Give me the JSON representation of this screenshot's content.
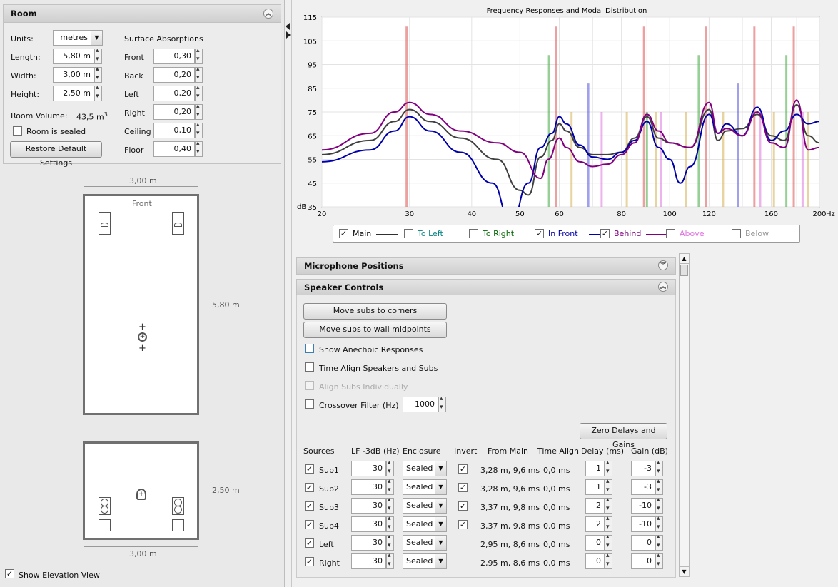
{
  "room_panel": {
    "title": "Room",
    "units_label": "Units:",
    "units_value": "metres",
    "length_label": "Length:",
    "length_value": "5,80 m",
    "width_label": "Width:",
    "width_value": "3,00 m",
    "height_label": "Height:",
    "height_value": "2,50 m",
    "volume_label": "Room Volume:",
    "volume_value": "43,5 m",
    "volume_unit_sup": "3",
    "sealed_label": "Room is sealed",
    "restore_button": "Restore Default Settings",
    "absorptions_title": "Surface Absorptions",
    "absorptions": [
      {
        "label": "Front",
        "value": "0,30"
      },
      {
        "label": "Back",
        "value": "0,20"
      },
      {
        "label": "Left",
        "value": "0,20"
      },
      {
        "label": "Right",
        "value": "0,20"
      },
      {
        "label": "Ceiling",
        "value": "0,10"
      },
      {
        "label": "Floor",
        "value": "0,40"
      }
    ]
  },
  "plan_view": {
    "width_dim": "3,00 m",
    "front_label": "Front",
    "length_dim": "5,80 m",
    "elev_width_dim": "3,00 m",
    "elev_height_dim": "2,50 m",
    "show_elevation_label": "Show Elevation View",
    "show_elevation_checked": true
  },
  "chart_data": {
    "type": "line",
    "title": "Frequency Responses and Modal Distribution",
    "ylabel": "dB",
    "xlabel": "Hz",
    "x_scale": "log",
    "x_ticks": [
      20,
      30,
      40,
      50,
      60,
      80,
      100,
      120,
      160,
      200
    ],
    "y_ticks": [
      35,
      45,
      55,
      65,
      75,
      85,
      95,
      105,
      115
    ],
    "ylim": [
      35,
      115
    ],
    "xlim": [
      20,
      200
    ],
    "grid": true,
    "series": [
      {
        "name": "Main",
        "color": "#404040",
        "x": [
          20,
          25,
          28,
          30,
          33,
          38,
          45,
          50,
          52,
          55,
          58,
          60,
          62,
          66,
          70,
          75,
          80,
          85,
          90,
          95,
          100,
          110,
          120,
          125,
          130,
          140,
          150,
          160,
          170,
          180,
          190,
          200
        ],
        "values": [
          57,
          63,
          71,
          76,
          71,
          64,
          55,
          42,
          40,
          56,
          63,
          70,
          67,
          60,
          57,
          57,
          58,
          64,
          73,
          64,
          62,
          60,
          76,
          63,
          67,
          68,
          74,
          65,
          63,
          78,
          65,
          62
        ]
      },
      {
        "name": "In Front",
        "color": "#0000aa",
        "x": [
          20,
          25,
          28,
          30,
          33,
          38,
          44,
          48,
          52,
          55,
          58,
          60,
          62,
          66,
          70,
          75,
          80,
          85,
          90,
          95,
          100,
          105,
          110,
          120,
          125,
          130,
          140,
          150,
          160,
          170,
          180,
          190,
          200
        ],
        "values": [
          54,
          59,
          67,
          73,
          67,
          58,
          45,
          28,
          45,
          60,
          66,
          73,
          70,
          61,
          56,
          55,
          58,
          63,
          71,
          60,
          55,
          45,
          52,
          74,
          66,
          70,
          65,
          77,
          63,
          67,
          74,
          70,
          71
        ]
      },
      {
        "name": "Behind",
        "color": "#800080",
        "x": [
          20,
          25,
          28,
          30,
          33,
          38,
          45,
          50,
          55,
          57,
          60,
          62,
          66,
          70,
          75,
          80,
          85,
          90,
          95,
          100,
          110,
          120,
          125,
          130,
          140,
          150,
          160,
          170,
          180,
          190,
          200
        ],
        "values": [
          59,
          66,
          75,
          79,
          74,
          67,
          62,
          58,
          47,
          55,
          64,
          60,
          54,
          52,
          53,
          57,
          62,
          74,
          67,
          62,
          60,
          79,
          66,
          68,
          65,
          75,
          62,
          60,
          80,
          59,
          60
        ]
      }
    ],
    "modes": [
      {
        "x": 29.6,
        "level": 111,
        "color": "#e06060"
      },
      {
        "x": 57.2,
        "level": 99,
        "color": "#50b050"
      },
      {
        "x": 59.2,
        "level": 111,
        "color": "#e06060"
      },
      {
        "x": 63.5,
        "level": 75,
        "color": "#d8b860"
      },
      {
        "x": 68.6,
        "level": 87,
        "color": "#6060e0"
      },
      {
        "x": 73.0,
        "level": 75,
        "color": "#e080e0"
      },
      {
        "x": 82.0,
        "level": 75,
        "color": "#d8b860"
      },
      {
        "x": 88.8,
        "level": 111,
        "color": "#e06060"
      },
      {
        "x": 90.0,
        "level": 75,
        "color": "#50b050"
      },
      {
        "x": 94.0,
        "level": 75,
        "color": "#d8b860"
      },
      {
        "x": 96.0,
        "level": 75,
        "color": "#e080e0"
      },
      {
        "x": 108.0,
        "level": 75,
        "color": "#d8b860"
      },
      {
        "x": 114.4,
        "level": 99,
        "color": "#50b050"
      },
      {
        "x": 118.4,
        "level": 111,
        "color": "#e06060"
      },
      {
        "x": 128.0,
        "level": 75,
        "color": "#d8b860"
      },
      {
        "x": 137.2,
        "level": 87,
        "color": "#6060e0"
      },
      {
        "x": 148.0,
        "level": 111,
        "color": "#e06060"
      },
      {
        "x": 152.0,
        "level": 75,
        "color": "#e080e0"
      },
      {
        "x": 162.0,
        "level": 75,
        "color": "#d8b860"
      },
      {
        "x": 171.6,
        "level": 99,
        "color": "#50b050"
      },
      {
        "x": 177.6,
        "level": 111,
        "color": "#e06060"
      },
      {
        "x": 185.0,
        "level": 75,
        "color": "#e080e0"
      },
      {
        "x": 190.0,
        "level": 75,
        "color": "#d8b860"
      }
    ],
    "legend": [
      {
        "name": "Main",
        "checked": true,
        "color": "#303030",
        "text_color": "#111111"
      },
      {
        "name": "To Left",
        "checked": false,
        "color": "#008080",
        "text_color": "#008080"
      },
      {
        "name": "To Right",
        "checked": false,
        "color": "#008000",
        "text_color": "#006600"
      },
      {
        "name": "In Front",
        "checked": true,
        "color": "#0000aa",
        "text_color": "#0000aa"
      },
      {
        "name": "Behind",
        "checked": true,
        "color": "#800080",
        "text_color": "#800080"
      },
      {
        "name": "Above",
        "checked": false,
        "color": "#e080e0",
        "text_color": "#e070e0"
      },
      {
        "name": "Below",
        "checked": false,
        "color": "#999999",
        "text_color": "#999999"
      }
    ]
  },
  "mic_panel": {
    "title": "Microphone Positions"
  },
  "speaker_panel": {
    "title": "Speaker Controls",
    "move_corners": "Move subs to corners",
    "move_midpoints": "Move subs to wall midpoints",
    "show_anechoic": "Show Anechoic Responses",
    "time_align": "Time Align Speakers and Subs",
    "align_individually": "Align Subs Individually",
    "crossover_label": "Crossover Filter (Hz)",
    "crossover_value": "1000",
    "zero_button": "Zero Delays and Gains",
    "headers": [
      "Sources",
      "LF -3dB (Hz)",
      "Enclosure",
      "Invert",
      "From Main",
      "Time Align",
      "Delay (ms)",
      "Gain (dB)"
    ],
    "rows": [
      {
        "name": "Sub1",
        "lf": "30",
        "enclosure": "Sealed",
        "invert": true,
        "from_main": "3,28 m, 9,6 ms",
        "time_align": "0,0 ms",
        "delay": "1",
        "gain": "-3"
      },
      {
        "name": "Sub2",
        "lf": "30",
        "enclosure": "Sealed",
        "invert": true,
        "from_main": "3,28 m, 9,6 ms",
        "time_align": "0,0 ms",
        "delay": "1",
        "gain": "-3"
      },
      {
        "name": "Sub3",
        "lf": "30",
        "enclosure": "Sealed",
        "invert": true,
        "from_main": "3,37 m, 9,8 ms",
        "time_align": "0,0 ms",
        "delay": "2",
        "gain": "-10"
      },
      {
        "name": "Sub4",
        "lf": "30",
        "enclosure": "Sealed",
        "invert": true,
        "from_main": "3,37 m, 9,8 ms",
        "time_align": "0,0 ms",
        "delay": "2",
        "gain": "-10"
      },
      {
        "name": "Left",
        "lf": "30",
        "enclosure": "Sealed",
        "invert": null,
        "from_main": "2,95 m, 8,6 ms",
        "time_align": "0,0 ms",
        "delay": "0",
        "gain": "0"
      },
      {
        "name": "Right",
        "lf": "30",
        "enclosure": "Sealed",
        "invert": null,
        "from_main": "2,95 m, 8,6 ms",
        "time_align": "0,0 ms",
        "delay": "0",
        "gain": "0"
      }
    ]
  }
}
